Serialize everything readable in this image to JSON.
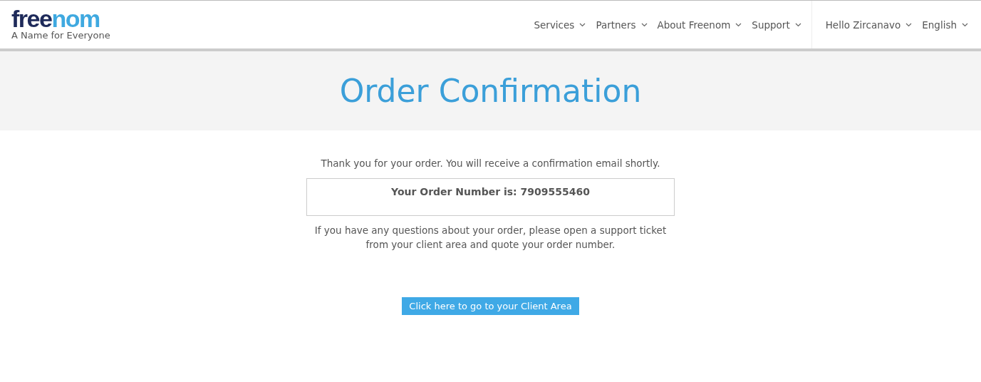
{
  "logo": {
    "start": "free",
    "end": "nom",
    "tagline": "A Name for Everyone"
  },
  "nav": [
    {
      "label": "Services"
    },
    {
      "label": "Partners"
    },
    {
      "label": "About Freenom"
    },
    {
      "label": "Support"
    }
  ],
  "account_nav": [
    {
      "label": "Hello Zircanavo"
    },
    {
      "label": "English"
    }
  ],
  "page_title": "Order Confirmation",
  "thanks": "Thank you for your order. You will receive a confirmation email shortly.",
  "order_number": "Your Order Number is: 7909555460",
  "help": "If you have any questions about your order, please open a support ticket from your client area and quote your order number.",
  "client_area_button": "Click here to go to your Client Area"
}
